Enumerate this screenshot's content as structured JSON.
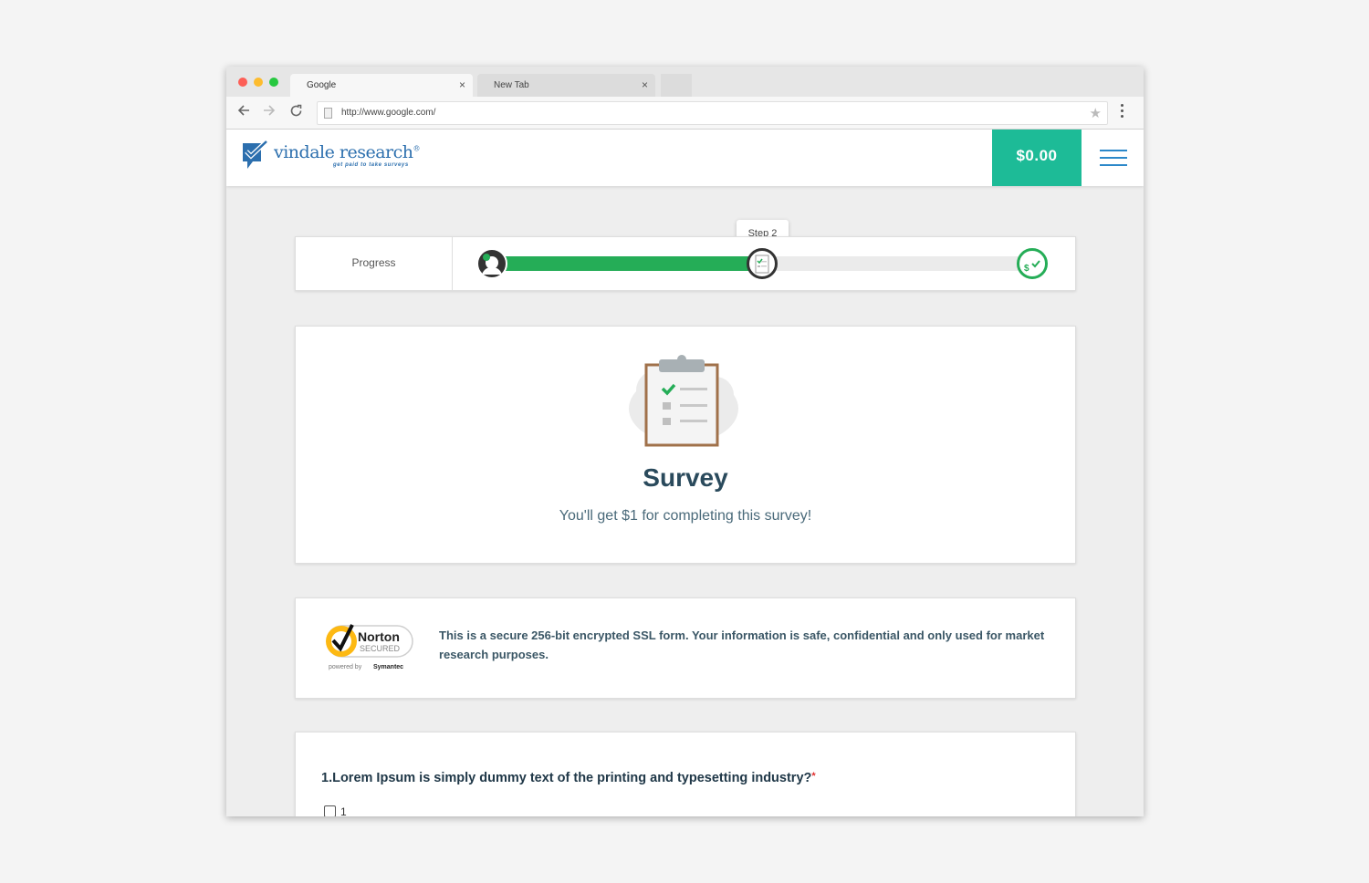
{
  "browser": {
    "tabs": [
      {
        "label": "Google",
        "close": "×"
      },
      {
        "label": "New Tab",
        "close": "×"
      }
    ],
    "url": "http://www.google.com/"
  },
  "header": {
    "logo_text": "vindale research",
    "logo_registered": "®",
    "logo_tagline": "get paid to take surveys",
    "balance": "$0.00",
    "accent_color": "#1dbb97"
  },
  "progress": {
    "label": "Progress",
    "tooltip": "Step 2",
    "completed_fraction": 0.5,
    "fill_color": "#25ad57"
  },
  "survey": {
    "title": "Survey",
    "subtitle": "You'll get $1 for completing this survey!"
  },
  "security": {
    "badge_name": "Norton",
    "badge_status": "SECURED",
    "badge_powered": "powered by",
    "badge_brand": "Symantec",
    "message": "This is a secure 256-bit encrypted SSL form. Your information is safe, confidential and only used for market research purposes."
  },
  "question": {
    "text": "1.Lorem Ipsum is simply dummy text of the printing and typesetting industry?",
    "required_mark": "*",
    "options": [
      "1"
    ]
  }
}
